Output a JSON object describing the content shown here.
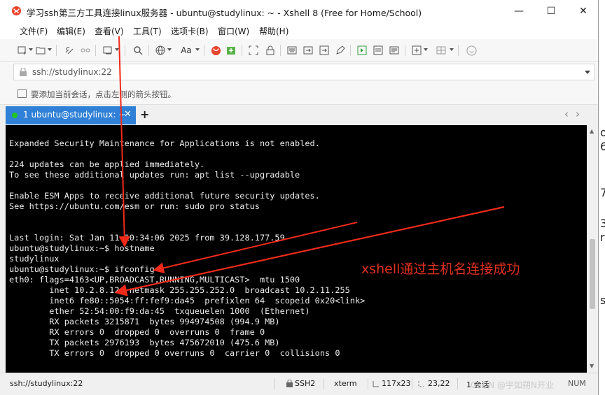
{
  "window": {
    "title": "学习ssh第三方工具连接linux服务器 - ubuntu@studylinux: ~ - Xshell 8 (Free for Home/School)",
    "minimize": "—",
    "maximize": "☐",
    "close": "✕"
  },
  "menu": [
    "文件(F)",
    "编辑(E)",
    "查看(V)",
    "工具(T)",
    "选项卡(B)",
    "窗口(W)",
    "帮助(H)"
  ],
  "toolbar": {
    "icons": [
      "new-session-icon",
      "open-folder-icon",
      "connect-icon",
      "disconnect-icon",
      "new-tab-icon",
      "find-icon",
      "globe-icon",
      "font-icon",
      "xshell-logo-icon",
      "xftp-icon",
      "fullscreen-icon",
      "lock-icon",
      "keyboard-icon",
      "tunnel-icon",
      "compose-icon",
      "script-icon",
      "send-icon",
      "log-icon",
      "add-icon",
      "layout-icon",
      "help-icon"
    ],
    "font_label": "Aa"
  },
  "address": {
    "value": "ssh://studylinux:22"
  },
  "hint": {
    "text": "要添加当前会话，点击左侧的箭头按钮。"
  },
  "tabs": {
    "active_label": "1 ubuntu@studylinux: ~",
    "close": "✕",
    "add": "+",
    "prev": "‹",
    "next": "›"
  },
  "terminal": {
    "lines": [
      "Expanded Security Maintenance for Applications is not enabled.",
      "",
      "224 updates can be applied immediately.",
      "To see these additional updates run: apt list --upgradable",
      "",
      "Enable ESM Apps to receive additional future security updates.",
      "See https://ubuntu.com/esm or run: sudo pro status",
      "",
      "",
      "Last login: Sat Jan 11 10:34:06 2025 from 39.128.177.59",
      "ubuntu@studylinux:~$ hostname",
      "studylinux",
      "ubuntu@studylinux:~$ ifconfig",
      "eth0: flags=4163<UP,BROADCAST,RUNNING,MULTICAST>  mtu 1500",
      "        inet 10.2.8.12  netmask 255.255.252.0  broadcast 10.2.11.255",
      "        inet6 fe80::5054:ff:fef9:da45  prefixlen 64  scopeid 0x20<link>",
      "        ether 52:54:00:f9:da:45  txqueuelen 1000  (Ethernet)",
      "        RX packets 3215871  bytes 994974508 (994.9 MB)",
      "        RX errors 0  dropped 0  overruns 0  frame 0",
      "        TX packets 2976193  bytes 475672010 (475.6 MB)",
      "        TX errors 0  dropped 0 overruns 0  carrier 0  collisions 0"
    ]
  },
  "annotation": {
    "text": "xshell通过主机名连接成功",
    "color": "#e03020"
  },
  "status": {
    "connection": "ssh://studylinux:22",
    "protocol": "SSH2",
    "terminal_type": "xterm",
    "size": "117x23",
    "cursor": "23,22",
    "sessions": "1 会话",
    "num": "NUM",
    "watermark": "CSDN @宇如朔N开业"
  },
  "background": {
    "chars": [
      "o",
      "6",
      "7",
      "3",
      "r",
      "s"
    ]
  },
  "colors": {
    "tab_active": "#2f80d6",
    "terminal_bg": "#000000",
    "terminal_fg": "#ececec",
    "session_dot": "#21c521"
  }
}
